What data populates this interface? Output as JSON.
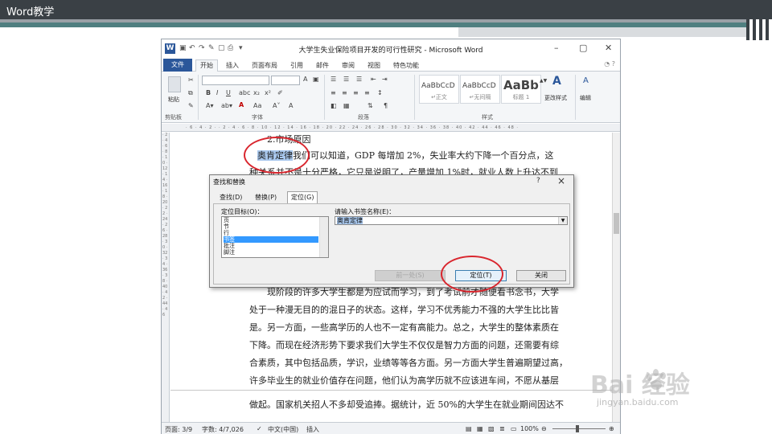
{
  "slide": {
    "title": "Word教学",
    "colors": {
      "header": "#3a4045",
      "accent_teal": "#4f7f80",
      "accent_blue": "#2b579a"
    }
  },
  "word": {
    "title": "大学生失业保险项目开发的可行性研究 - Microsoft Word",
    "app_icon": "W",
    "tabs": [
      "文件",
      "开始",
      "插入",
      "页面布局",
      "引用",
      "邮件",
      "审阅",
      "视图",
      "特色功能"
    ],
    "active_tab": "开始",
    "ribbon": {
      "groups": [
        "剪贴板",
        "字体",
        "段落",
        "样式"
      ],
      "paste_label": "粘贴",
      "styles": [
        {
          "preview": "AaBbCcD",
          "name": "↵正文"
        },
        {
          "preview": "AaBbCcD",
          "name": "↵无间隔"
        },
        {
          "preview": "AaBb",
          "name": "标题 1"
        }
      ],
      "change_styles": "更改样式",
      "edit": "编辑"
    },
    "document": {
      "heading": "2.市场原因",
      "highlighted": "奥肯定律",
      "lines": [
        "我们可以知道，GDP 每增加 2%，失业率大约下降一个百分点，这",
        "种关系并不是十分严格，它只是说明了，产量增加 1%时，就业人数上升达不到",
        "现阶段的许多大学生都是为应试而学习，到了考试前才随便看书念书，大学",
        "处于一种漫无目的的混日子的状态。这样，学习不优秀能力不强的大学生比比皆",
        "是。另一方面，一些高学历的人也不一定有高能力。总之，大学生的整体素质在",
        "下降。而现在经济形势下要求我们大学生不仅仅是智力方面的问题，还需要有综",
        "合素质，其中包括品质，学识，业绩等等各方面。另一方面大学生普遍期望过高，",
        "许多毕业生的就业价值存在问题，他们认为高学历就不应该进车间，不愿从基层",
        "做起。国家机关招人不多却受追捧。据统计，近 50%的大学生在就业期间因达不"
      ]
    },
    "status": {
      "page": "页面: 3/9",
      "words": "字数: 4/7,026",
      "lang": "中文(中国)",
      "mode": "插入",
      "zoom": "100%"
    }
  },
  "dialog": {
    "title": "查找和替换",
    "help": "?",
    "tabs": [
      "查找(D)",
      "替换(P)",
      "定位(G)"
    ],
    "active_tab": "定位(G)",
    "target_label": "定位目标(O)：",
    "targets": [
      "页",
      "节",
      "行",
      "书签",
      "批注",
      "脚注"
    ],
    "selected_target": "书签",
    "bookmark_label": "请输入书签名称(E)：",
    "bookmark_value": "奥肯定律",
    "buttons": {
      "previous": "前一处(S)",
      "goto": "定位(T)",
      "close": "关闭"
    }
  },
  "watermark": {
    "brand": "Bai  经验",
    "url": "jingyan.baidu.com"
  }
}
